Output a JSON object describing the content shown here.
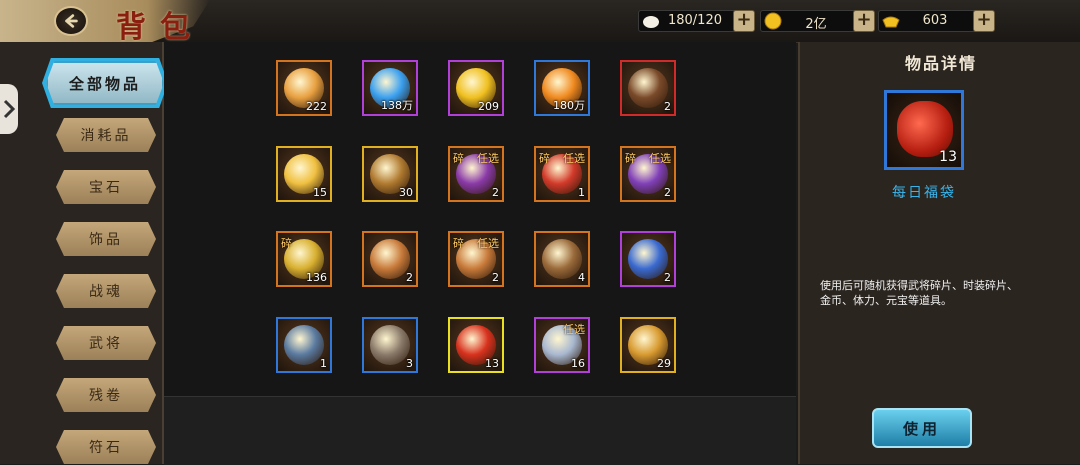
{
  "header": {
    "title": "背包",
    "resources": [
      {
        "name": "stamina",
        "value": "180/120"
      },
      {
        "name": "gold",
        "value": "2亿"
      },
      {
        "name": "ingot",
        "value": "603"
      }
    ]
  },
  "categories": [
    "全部物品",
    "消耗品",
    "宝石",
    "饰品",
    "战魂",
    "武将",
    "残卷",
    "符石"
  ],
  "items": [
    {
      "count": "222",
      "frame": "#d4741e",
      "color": "#e8a040"
    },
    {
      "count": "138万",
      "frame": "#b040d8",
      "color": "#3aa0f0"
    },
    {
      "count": "209",
      "frame": "#b040d8",
      "color": "#f0c020"
    },
    {
      "count": "180万",
      "frame": "#2f77d8",
      "color": "#f08a20"
    },
    {
      "count": "2",
      "frame": "#d02a2a",
      "color": "#7a4a2a"
    },
    {
      "count": "15",
      "frame": "#e0b020",
      "color": "#f0c040"
    },
    {
      "count": "30",
      "frame": "#e0b020",
      "color": "#b07a30"
    },
    {
      "count": "2",
      "frame": "#d4741e",
      "color": "#8a3aa8",
      "tag_left": "碎",
      "tag_right": "任选"
    },
    {
      "count": "1",
      "frame": "#d4741e",
      "color": "#d23a2a",
      "tag_left": "碎",
      "tag_right": "任选"
    },
    {
      "count": "2",
      "frame": "#d4741e",
      "color": "#8040b8",
      "tag_left": "碎",
      "tag_right": "任选"
    },
    {
      "count": "136",
      "frame": "#d4741e",
      "color": "#d8b030",
      "tag_left": "碎"
    },
    {
      "count": "2",
      "frame": "#d4741e",
      "color": "#c87a3a"
    },
    {
      "count": "2",
      "frame": "#d4741e",
      "color": "#c87a3a",
      "tag_left": "碎",
      "tag_right": "任选"
    },
    {
      "count": "4",
      "frame": "#d4741e",
      "color": "#9a6a3a"
    },
    {
      "count": "2",
      "frame": "#b040d8",
      "color": "#3a6ad0"
    },
    {
      "count": "1",
      "frame": "#2f77d8",
      "color": "#5a7aa0"
    },
    {
      "count": "3",
      "frame": "#2f77d8",
      "color": "#8a7a6a"
    },
    {
      "count": "13",
      "frame": "#e8e020",
      "color": "#d8321e"
    },
    {
      "count": "16",
      "frame": "#b040d8",
      "color": "#a8b8d0",
      "tag_right": "任选"
    },
    {
      "count": "29",
      "frame": "#e0b020",
      "color": "#d89a30"
    }
  ],
  "detail": {
    "heading": "物品详情",
    "count": "13",
    "name": "每日福袋",
    "description": "使用后可随机获得武将碎片、时装碎片、金币、体力、元宝等道具。",
    "use_label": "使用"
  }
}
